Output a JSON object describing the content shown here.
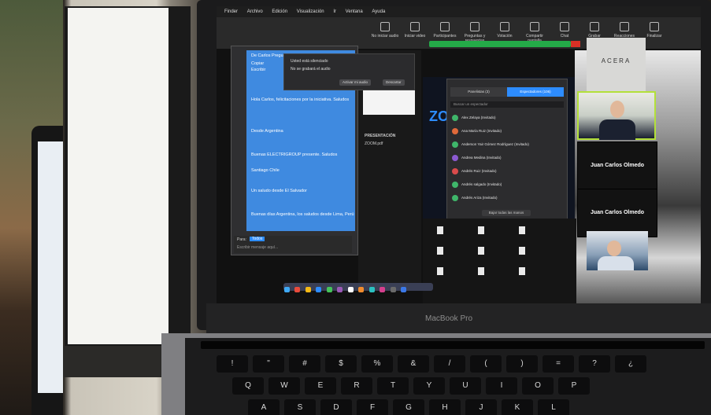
{
  "laptop": {
    "brand_label": "MacBook Pro"
  },
  "menubar": {
    "items": [
      "Finder",
      "Archivo",
      "Edición",
      "Visualización",
      "Ir",
      "Ventana",
      "Ayuda"
    ]
  },
  "zoom_toolbar": {
    "buttons": [
      "No iniciar audio",
      "Iniciar video",
      "Participantes",
      "Preguntas y respuestas",
      "Votación",
      "Compartir pantalla",
      "Chat",
      "Grabar",
      "Reacciones",
      "Finalizar"
    ]
  },
  "notice": {
    "title": "Usted está silenciado",
    "subtitle": "No se grabará el audio",
    "buttons": [
      "Activar mi audio",
      "Descartar"
    ]
  },
  "chat": {
    "header_lines": [
      "De Carlos Pregunta",
      "Copiar",
      "Escribir"
    ],
    "messages": [
      "Hola Carlos, felicitaciones por la iniciativa. Saludos",
      "Desde Argentina",
      "Buenas ELECTRIGROUP presente. Saludos",
      "Santiago Chile",
      "Un saludo desde El Salvador",
      "Buenas días Argentina, los saludos desde Lima, Perú"
    ],
    "to_label": "Para:",
    "to_value": "Todos",
    "input_placeholder": "Escribir mensaje aquí..."
  },
  "presentation": {
    "title": "PRESENTACIÓN",
    "file": "ZOOM.pdf"
  },
  "participants": {
    "tabs": [
      "Panelistas (3)",
      "Espectadores (106)"
    ],
    "search_placeholder": "Buscar un espectador",
    "rows": [
      {
        "name": "Alex Zelaya (Invitado)",
        "color": "#3fb66a"
      },
      {
        "name": "Ana María Ruiz (Invitado)",
        "color": "#e06a3a"
      },
      {
        "name": "Anderson Yair Gómez Rodríguez (Invitado)",
        "color": "#3fb66a"
      },
      {
        "name": "Andrea Medina (Invitado)",
        "color": "#8b5ad1"
      },
      {
        "name": "Andrés Ruiz (Invitado)",
        "color": "#d94b4b"
      },
      {
        "name": "Andrés salgado (Invitado)",
        "color": "#3fb66a"
      },
      {
        "name": "Andrés Ariza (Invitado)",
        "color": "#3fb66a"
      }
    ],
    "view_all": "Bajar todas las manos"
  },
  "zoom_brand": "ZOO",
  "videos": [
    {
      "label": "ACERA"
    },
    {
      "label": "Juan Carlos Olmedo"
    },
    {
      "label": "Juan Carlos Olmedo"
    }
  ],
  "colors": {
    "zoom_blue": "#2d8cff",
    "chat_blue": "#3f8ae0",
    "active_speaker": "#b3e03a",
    "recording_green": "#24aa48"
  },
  "keyboard": {
    "row1": [
      "!",
      "\"",
      "#",
      "$",
      "%",
      "&",
      "/",
      "(",
      ")",
      "=",
      "?",
      "¿"
    ],
    "row2": [
      "Q",
      "W",
      "E",
      "R",
      "T",
      "Y",
      "U",
      "I",
      "O",
      "P"
    ],
    "row3": [
      "A",
      "S",
      "D",
      "F",
      "G",
      "H",
      "J",
      "K",
      "L"
    ]
  }
}
